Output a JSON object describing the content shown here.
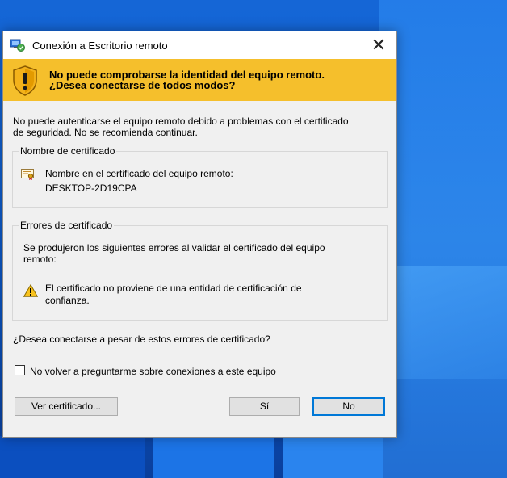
{
  "dialog": {
    "title": "Conexión a Escritorio remoto",
    "close_symbol": "✕",
    "app_icon": "remote-desktop-icon",
    "banner": {
      "line1": "No puede comprobarse la identidad del equipo remoto.",
      "line2": "¿Desea conectarse de todos modos?",
      "icon": "security-shield-warning-icon",
      "color": "#f5bf2c"
    },
    "body_line1": "No puede autenticarse el equipo remoto debido a problemas con el certificado",
    "body_line2": "de seguridad. No se recomienda continuar.",
    "cert_name_group": {
      "legend": "Nombre de certificado",
      "label": "Nombre en el certificado del equipo remoto:",
      "value": "DESKTOP-2D19CPA",
      "icon": "certificate-icon"
    },
    "cert_errors_group": {
      "legend": "Errores de certificado",
      "desc_line1": "Se produjeron los siguientes errores al validar el certificado del equipo",
      "desc_line2": "remoto:",
      "error_line1": "El certificado no proviene de una entidad de certificación de",
      "error_line2": "confianza.",
      "icon": "warning-icon"
    },
    "question": "¿Desea conectarse a pesar de estos errores de certificado?",
    "checkbox_label": "No volver a preguntarme sobre conexiones a este equipo",
    "checkbox_checked": false,
    "buttons": {
      "view_certificate": "Ver certificado...",
      "yes": "Sí",
      "no": "No"
    }
  }
}
